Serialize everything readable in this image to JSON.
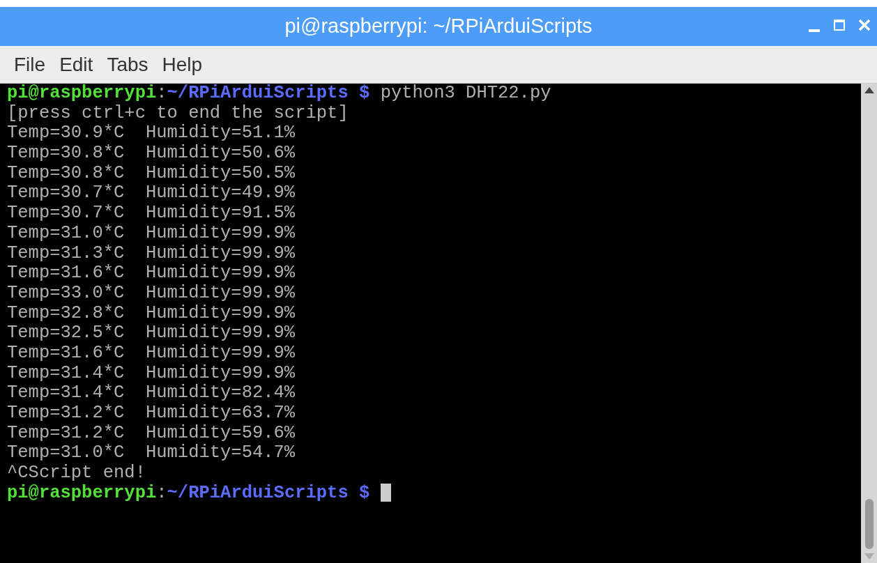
{
  "window": {
    "title": "pi@raspberrypi: ~/RPiArduiScripts"
  },
  "menu": [
    "File",
    "Edit",
    "Tabs",
    "Help"
  ],
  "terminal": {
    "lines": [
      {
        "kind": "prompt",
        "user": "pi@raspberrypi",
        "separator": ":",
        "path": "~/RPiArduiScripts",
        "symbol": "$",
        "command": "python3 DHT22.py",
        "cursor": false
      },
      {
        "kind": "output",
        "text": "[press ctrl+c to end the script]"
      },
      {
        "kind": "output",
        "text": "Temp=30.9*C  Humidity=51.1%"
      },
      {
        "kind": "output",
        "text": "Temp=30.8*C  Humidity=50.6%"
      },
      {
        "kind": "output",
        "text": "Temp=30.8*C  Humidity=50.5%"
      },
      {
        "kind": "output",
        "text": "Temp=30.7*C  Humidity=49.9%"
      },
      {
        "kind": "output",
        "text": "Temp=30.7*C  Humidity=91.5%"
      },
      {
        "kind": "output",
        "text": "Temp=31.0*C  Humidity=99.9%"
      },
      {
        "kind": "output",
        "text": "Temp=31.3*C  Humidity=99.9%"
      },
      {
        "kind": "output",
        "text": "Temp=31.6*C  Humidity=99.9%"
      },
      {
        "kind": "output",
        "text": "Temp=33.0*C  Humidity=99.9%"
      },
      {
        "kind": "output",
        "text": "Temp=32.8*C  Humidity=99.9%"
      },
      {
        "kind": "output",
        "text": "Temp=32.5*C  Humidity=99.9%"
      },
      {
        "kind": "output",
        "text": "Temp=31.6*C  Humidity=99.9%"
      },
      {
        "kind": "output",
        "text": "Temp=31.4*C  Humidity=99.9%"
      },
      {
        "kind": "output",
        "text": "Temp=31.4*C  Humidity=82.4%"
      },
      {
        "kind": "output",
        "text": "Temp=31.2*C  Humidity=63.7%"
      },
      {
        "kind": "output",
        "text": "Temp=31.2*C  Humidity=59.6%"
      },
      {
        "kind": "output",
        "text": "Temp=31.0*C  Humidity=54.7%"
      },
      {
        "kind": "output",
        "text": "^CScript end!"
      },
      {
        "kind": "prompt",
        "user": "pi@raspberrypi",
        "separator": ":",
        "path": "~/RPiArduiScripts",
        "symbol": "$",
        "cursor": true
      }
    ]
  }
}
